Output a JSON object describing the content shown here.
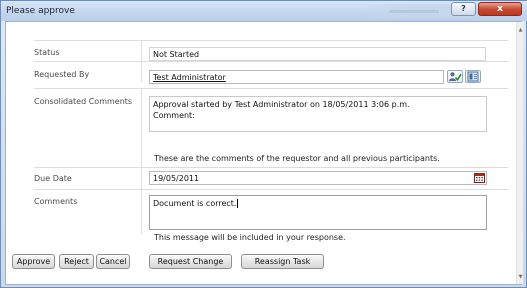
{
  "window": {
    "title": "Please approve",
    "help_glyph": "?",
    "close_glyph": "x"
  },
  "form": {
    "status": {
      "label": "Status",
      "value": "Not Started"
    },
    "requested_by": {
      "label": "Requested By",
      "value": "Test Administrator"
    },
    "consolidated_comments": {
      "label": "Consolidated Comments",
      "line1": "Approval started by Test Administrator on 18/05/2011 3:06 p.m.",
      "line2": "Comment:",
      "hint": "These are the comments of the requestor and all previous participants."
    },
    "due_date": {
      "label": "Due Date",
      "value": "19/05/2011"
    },
    "comments": {
      "label": "Comments",
      "value": "Document is correct.",
      "hint": "This message will be included in your response."
    }
  },
  "buttons": {
    "approve": "Approve",
    "reject": "Reject",
    "cancel": "Cancel",
    "request_change": "Request Change",
    "reassign_task": "Reassign Task"
  },
  "icons": {
    "check_names": "check-names-icon",
    "browse_people": "address-book-icon",
    "date_picker": "calendar-icon"
  }
}
